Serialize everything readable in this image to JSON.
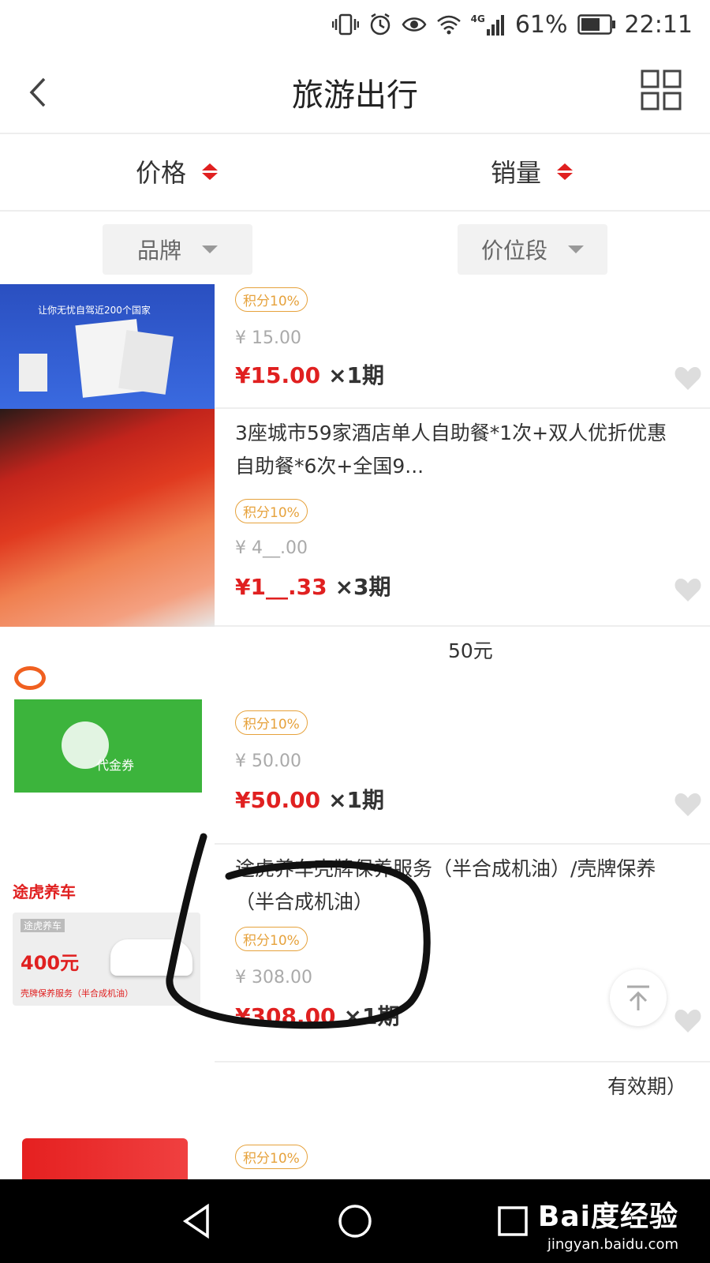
{
  "status_bar": {
    "network": "4G",
    "battery": "61%",
    "time": "22:11"
  },
  "header": {
    "title": "旅游出行",
    "back_icon": "chevron-left-icon",
    "grid_icon": "grid-icon"
  },
  "sort_bar": {
    "price_label": "价格",
    "sales_label": "销量"
  },
  "filter_bar": {
    "brand_label": "品牌",
    "price_range_label": "价位段"
  },
  "products": [
    {
      "title": "",
      "badge": "积分10%",
      "original_price": "¥ 15.00",
      "current_price": "¥15.00",
      "installment": "×1期",
      "image_text": "让你无忧自驾近200个国家"
    },
    {
      "title": "3座城市59家酒店单人自助餐*1次+双人优折优惠自助餐*6次+全国9...",
      "badge": "积分10%",
      "original_price": "¥ 4__.00",
      "current_price": "¥1__.33",
      "installment": "×3期"
    },
    {
      "title": "50元",
      "badge": "积分10%",
      "original_price": "¥ 50.00",
      "current_price": "¥50.00",
      "installment": "×1期",
      "image_text": "代金券"
    },
    {
      "title": "途虎养车壳牌保养服务（半合成机油）/壳牌保养（半合成机油）",
      "badge": "积分10%",
      "original_price": "¥ 308.00",
      "current_price": "¥308.00",
      "installment": "×1期",
      "image_brand": "途虎养车",
      "image_card_brand": "途虎养车",
      "image_price": "400元",
      "image_caption": "壳牌保养服务（半合成机油）"
    },
    {
      "title": "有效期）",
      "badge": "积分10%"
    }
  ],
  "nav_bar": {
    "watermark_logo": "Bai度经验",
    "watermark_url": "jingyan.baidu.com"
  },
  "colors": {
    "accent_red": "#e02020",
    "badge_orange": "#e6a23c",
    "divider": "#eeeeee"
  }
}
